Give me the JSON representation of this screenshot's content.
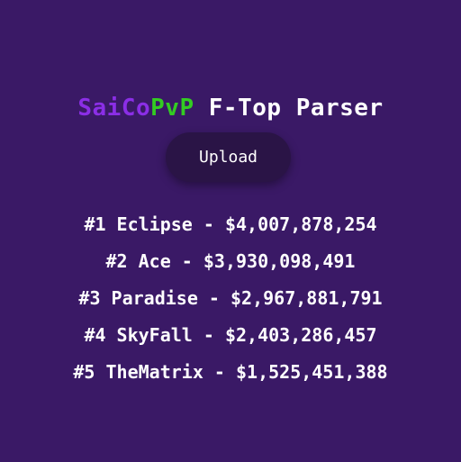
{
  "title": {
    "part1": "SaiCo",
    "part2": "PvP",
    "part3": " F-Top Parser"
  },
  "colors": {
    "background": "#3a1966",
    "saico": "#8b2ee6",
    "pvp": "#33cc22",
    "button": "#2a1446"
  },
  "upload": {
    "label": "Upload"
  },
  "ftop": {
    "entries": [
      "#1 Eclipse - $4,007,878,254",
      "#2 Ace - $3,930,098,491",
      "#3 Paradise - $2,967,881,791",
      "#4 SkyFall - $2,403,286,457",
      "#5 TheMatrix - $1,525,451,388"
    ]
  }
}
